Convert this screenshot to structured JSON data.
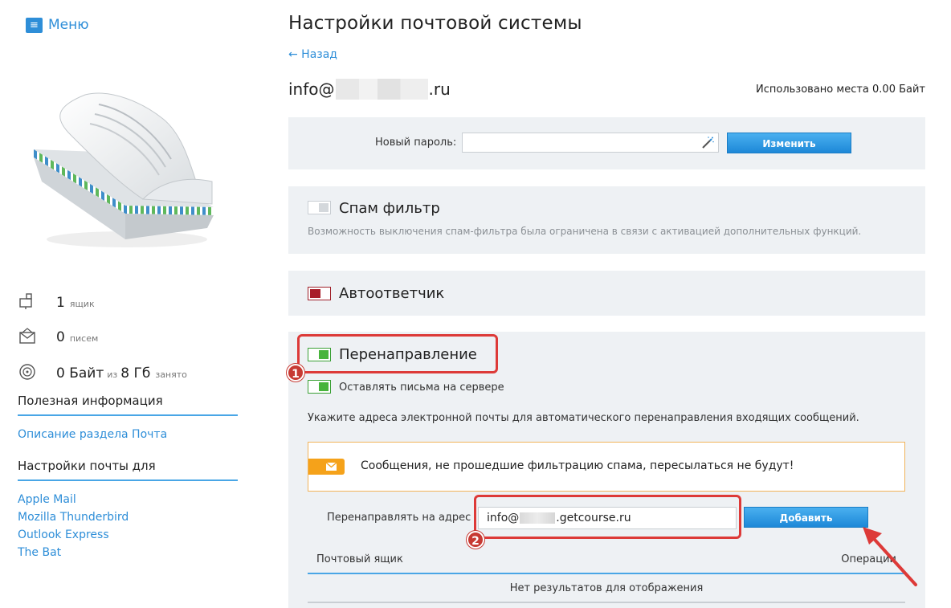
{
  "menu": {
    "label": "Меню",
    "icon": "hamburger-icon"
  },
  "stats": {
    "mailboxes": {
      "count": "1",
      "unit": "ящик",
      "icon": "mailbox-icon"
    },
    "letters": {
      "count": "0",
      "unit": "писем",
      "icon": "envelope-icon"
    },
    "storage": {
      "used": "0 Байт",
      "of_word": "из",
      "total": "8 Гб",
      "suffix": "занято",
      "icon": "disk-icon"
    }
  },
  "sidebar": {
    "useful_info_heading": "Полезная информация",
    "useful_links": [
      "Описание раздела Почта"
    ],
    "clients_heading": "Настройки почты для",
    "client_links": [
      "Apple Mail",
      "Mozilla Thunderbird",
      "Outlook Express",
      "The Bat"
    ]
  },
  "header": {
    "title": "Настройки почтовой системы",
    "back_label": "← Назад",
    "mailbox_prefix": "info@",
    "mailbox_suffix": ".ru",
    "space_used": "Использовано места 0.00 Байт"
  },
  "password": {
    "label": "Новый пароль:",
    "value": "",
    "wand_icon": "magic-wand-icon",
    "button": "Изменить"
  },
  "spam": {
    "title": "Спам фильтр",
    "note": "Возможность выключения спам-фильтра была ограничена в связи с активацией дополнительных функций.",
    "enabled": false
  },
  "autoresponder": {
    "title": "Автоответчик",
    "enabled": false
  },
  "forwarding": {
    "title": "Перенаправление",
    "enabled": true,
    "keep_label": "Оставлять письма на сервере",
    "keep_enabled": true,
    "instruction": "Укажите адреса электронной почты для автоматического перенаправления входящих сообщений.",
    "warning": "Сообщения, не прошедшие фильтрацию спама, пересылаться не будут!",
    "address_label": "Перенаправлять на адрес",
    "address_prefix": "info@",
    "address_suffix": ".getcourse.ru",
    "add_button": "Добавить",
    "table": {
      "col_mailbox": "Почтовый ящик",
      "col_operations": "Операции",
      "empty": "Нет результатов для отображения"
    }
  },
  "annotations": {
    "first": "1",
    "second": "2"
  },
  "colors": {
    "accent": "#2e8ed8",
    "panel": "#eef1f4",
    "annotation": "#dd3a38",
    "toggle_on": "#48b43c",
    "toggle_red": "#a81e2a",
    "warning": "#f5a21a"
  }
}
